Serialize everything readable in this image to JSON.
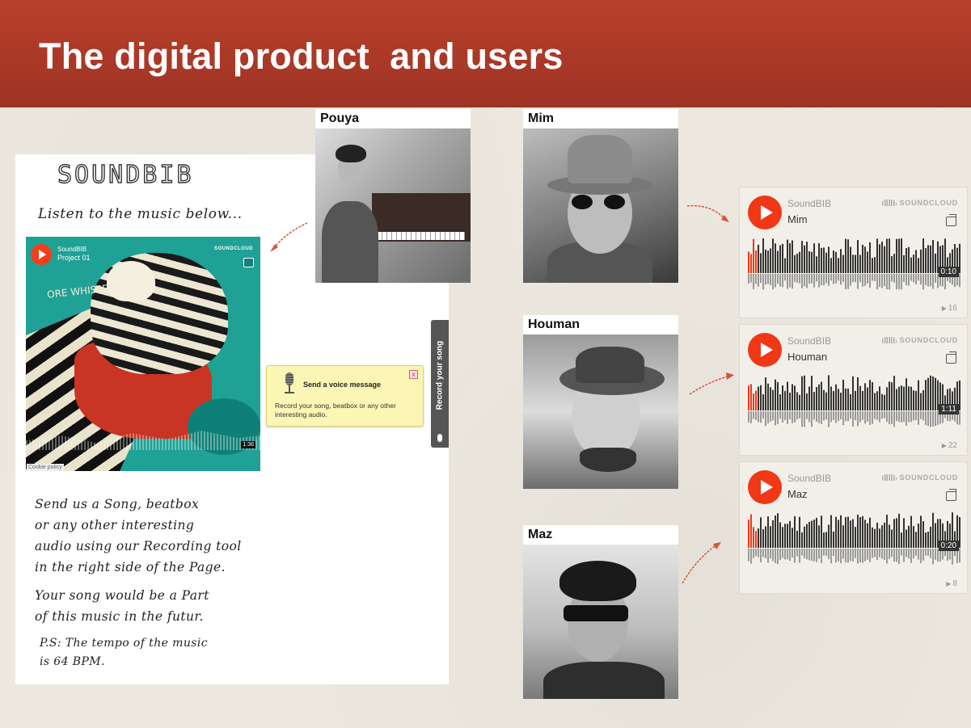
{
  "slide": {
    "title": "The digital product  and users"
  },
  "webpage": {
    "logo": "SOUNDBIB",
    "listen": "Listen to the music below...",
    "player": {
      "user": "SoundBIB",
      "track": "Project 01",
      "brand": "SOUNDCLOUD",
      "time": "1:36",
      "cookie": "Cookie policy",
      "art_text": "ORE WHISPERS"
    },
    "voice": {
      "title": "Send a voice message",
      "close": "x",
      "body": "Record your song, beatbox or any other interesting audio."
    },
    "record_button": "Record your song",
    "send_lines": [
      "Send us a Song, beatbox",
      "or any other interesting",
      "audio using our Recording tool",
      "in the right side of the Page."
    ],
    "your_lines": [
      "Your song would be a Part",
      "of this music in the futur."
    ],
    "ps_lines": [
      "P.S: The tempo of the music",
      "is 64 BPM."
    ]
  },
  "users": [
    {
      "name": "Pouya"
    },
    {
      "name": "Mim"
    },
    {
      "name": "Houman"
    },
    {
      "name": "Maz"
    }
  ],
  "widgets": [
    {
      "user": "SoundBIB",
      "track": "Mim",
      "brand": "SOUNDCLOUD",
      "time": "0:10",
      "plays": "16"
    },
    {
      "user": "SoundBIB",
      "track": "Houman",
      "brand": "SOUNDCLOUD",
      "time": "1:11",
      "plays": "22"
    },
    {
      "user": "SoundBIB",
      "track": "Maz",
      "brand": "SOUNDCLOUD",
      "time": "0:20",
      "plays": "8"
    }
  ],
  "colors": {
    "banner": "#ae3a29",
    "soundcloud_orange": "#f03716",
    "arrow": "#d2553e"
  }
}
